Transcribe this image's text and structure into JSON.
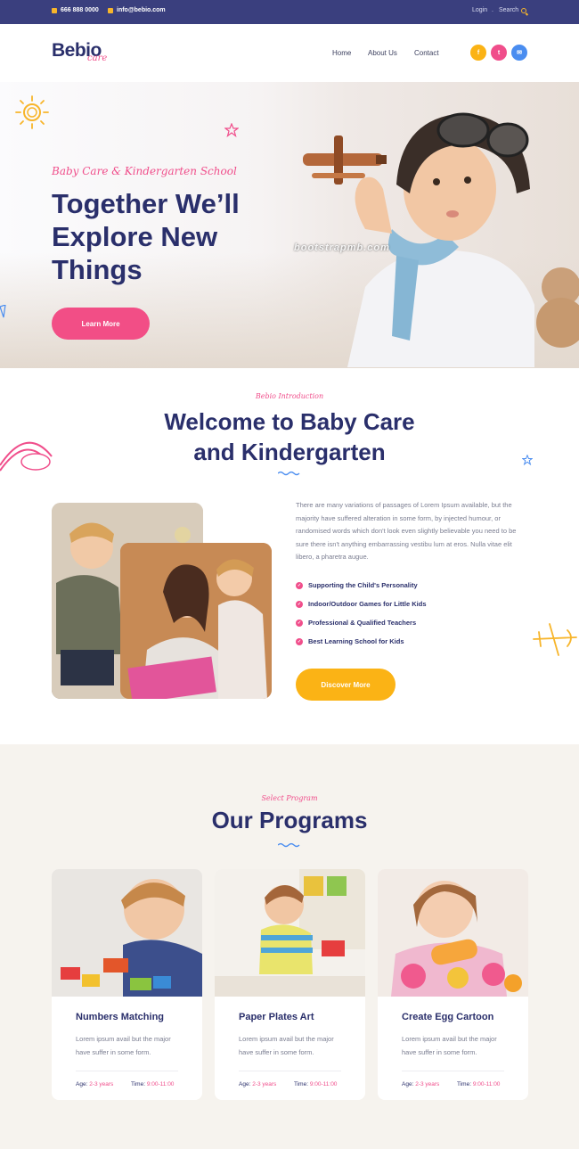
{
  "topbar": {
    "phone": "666 888 0000",
    "email": "info@bebio.com",
    "login": "Login",
    "search": "Search"
  },
  "header": {
    "logo_main": "Bebio",
    "logo_sub": "care",
    "nav": [
      "Home",
      "About Us",
      "Contact"
    ],
    "social": [
      {
        "icon": "facebook-icon",
        "glyph": "f",
        "color": "#fbb315"
      },
      {
        "icon": "twitter-icon",
        "glyph": "t",
        "color": "#f04e8b"
      },
      {
        "icon": "mail-icon",
        "glyph": "✉",
        "color": "#4a8df0"
      }
    ]
  },
  "hero": {
    "pretitle": "Baby Care & Kindergarten School",
    "title": "Together We’ll Explore New Things",
    "button": "Learn More",
    "watermark": "bootstrapmb.com"
  },
  "intro": {
    "pretitle": "Bebio Introduction",
    "title": "Welcome to Baby Care and Kindergarten",
    "paragraph": "There are many variations of passages of Lorem Ipsum available, but the majority have suffered alteration in some form, by injected humour, or randomised words which don't look even slightly believable you need to be sure there isn't anything embarrassing vestibu lum at eros. Nulla vitae elit libero, a pharetra augue.",
    "features": [
      "Supporting the Child's Personality",
      "Indoor/Outdoor Games for Little Kids",
      "Professional & Qualified Teachers",
      "Best Learning School for Kids"
    ],
    "button": "Discover More"
  },
  "programs": {
    "pretitle": "Select Program",
    "title": "Our Programs",
    "age_label": "Age:",
    "time_label": "Time:",
    "cards": [
      {
        "title": "Numbers Matching",
        "desc": "Lorem ipsum avail but the major have suffer in some form.",
        "age": "2-3 years",
        "time": "9:00-11:00"
      },
      {
        "title": "Paper Plates Art",
        "desc": "Lorem ipsum avail but the major have suffer in some form.",
        "age": "2-3 years",
        "time": "9:00-11:00"
      },
      {
        "title": "Create Egg Cartoon",
        "desc": "Lorem ipsum avail but the major have suffer in some form.",
        "age": "2-3 years",
        "time": "9:00-11:00"
      }
    ]
  },
  "colors": {
    "navy": "#2a2f6b",
    "topbar": "#3a3f7e",
    "pink": "#f04e8b",
    "yellow": "#fbb315",
    "section_bg": "#f6f3ee"
  }
}
